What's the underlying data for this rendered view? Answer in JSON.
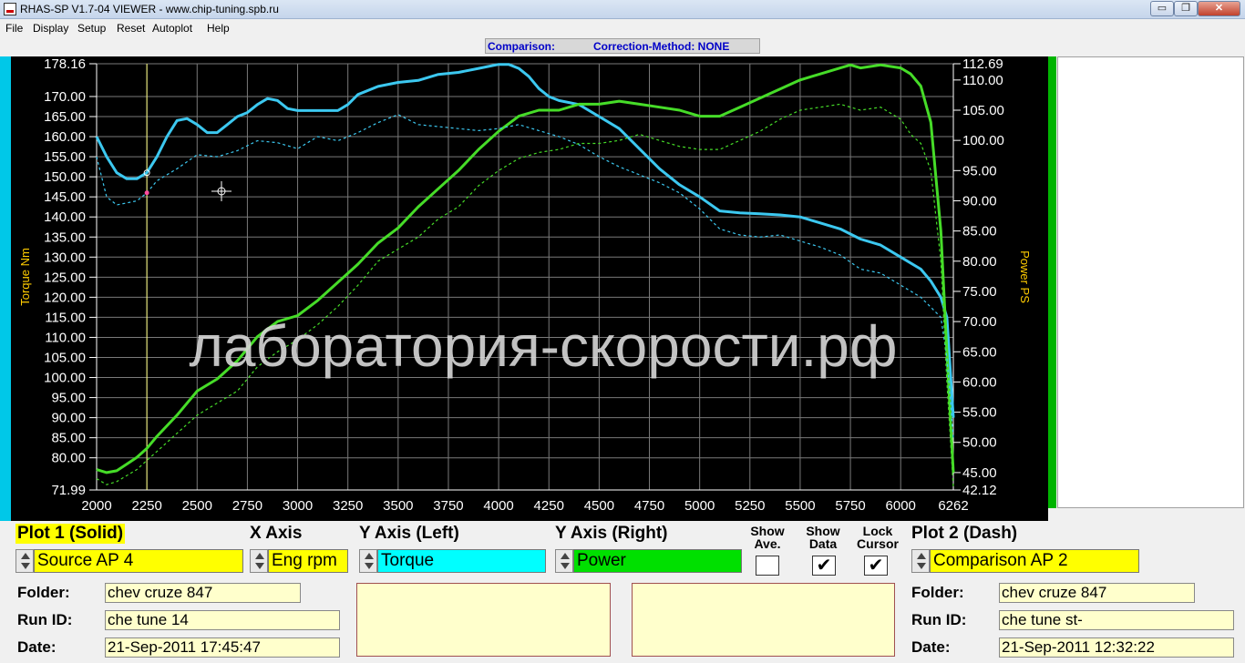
{
  "window": {
    "title": "RHAS-SP V1.7-04  VIEWER - www.chip-tuning.spb.ru",
    "min_glyph": "▭",
    "max_glyph": "❐",
    "close_glyph": "✕"
  },
  "menu": [
    "File",
    "Display",
    "Setup",
    "Reset",
    "Autoplot",
    "Help"
  ],
  "header": {
    "comparison": "Comparison:",
    "correction": "Correction-Method: NONE"
  },
  "chart_data": {
    "type": "line",
    "ylabel_left": "Torque Nm",
    "ylabel_right": "Power PS",
    "watermark": "лаборатория-скорости.рф",
    "xlim": [
      2000,
      6262
    ],
    "ylim_left": [
      71.99,
      178.16
    ],
    "ylim_right": [
      42.12,
      112.69
    ],
    "x_ticks": [
      "2000",
      "2250",
      "2500",
      "2750",
      "3000",
      "3250",
      "3500",
      "3750",
      "4000",
      "4250",
      "4500",
      "4750",
      "5000",
      "5250",
      "5500",
      "5750",
      "6000",
      "6262"
    ],
    "y_ticks_left": [
      "178.16",
      "170.00",
      "165.00",
      "160.00",
      "155.00",
      "150.00",
      "145.00",
      "140.00",
      "135.00",
      "130.00",
      "125.00",
      "120.00",
      "115.00",
      "110.00",
      "105.00",
      "100.00",
      "95.00",
      "90.00",
      "85.00",
      "80.00",
      "71.99"
    ],
    "y_ticks_right": [
      "112.69",
      "110.00",
      "105.00",
      "100.00",
      "95.00",
      "90.00",
      "85.00",
      "80.00",
      "75.00",
      "70.00",
      "65.00",
      "60.00",
      "55.00",
      "50.00",
      "45.00",
      "42.12"
    ],
    "cursor_x": 2250,
    "grid": true,
    "series": [
      {
        "name": "Torque",
        "axis": "left",
        "style": "solid",
        "color": "#3cc8f0",
        "x": [
          2000,
          2050,
          2100,
          2150,
          2200,
          2250,
          2300,
          2350,
          2400,
          2450,
          2500,
          2550,
          2600,
          2650,
          2700,
          2750,
          2800,
          2850,
          2900,
          2950,
          3000,
          3100,
          3200,
          3250,
          3300,
          3400,
          3500,
          3600,
          3700,
          3800,
          3900,
          3950,
          4000,
          4050,
          4100,
          4150,
          4200,
          4250,
          4300,
          4400,
          4500,
          4600,
          4700,
          4800,
          4900,
          5000,
          5100,
          5200,
          5300,
          5400,
          5500,
          5600,
          5700,
          5800,
          5900,
          6000,
          6100,
          6150,
          6200,
          6230,
          6262
        ],
        "y": [
          160.0,
          155.0,
          151.0,
          149.5,
          149.5,
          151.0,
          155.0,
          160.0,
          164.0,
          164.5,
          163.0,
          161.0,
          161.0,
          163.0,
          165.0,
          166.0,
          168.0,
          169.5,
          169.0,
          167.0,
          166.5,
          166.5,
          166.5,
          168.0,
          170.5,
          172.5,
          173.5,
          174.0,
          175.5,
          176.0,
          177.0,
          177.5,
          178.0,
          178.0,
          177.0,
          175.0,
          172.0,
          170.0,
          169.0,
          168.0,
          165.0,
          162.0,
          157.0,
          152.0,
          148.0,
          145.0,
          141.5,
          141.0,
          140.8,
          140.5,
          140.0,
          138.5,
          137.0,
          134.5,
          133.0,
          130.0,
          127.0,
          124.0,
          120.0,
          115.0,
          90.0
        ]
      },
      {
        "name": "Power",
        "axis": "right",
        "style": "solid",
        "color": "#46dc28",
        "x": [
          2000,
          2050,
          2100,
          2200,
          2250,
          2300,
          2400,
          2500,
          2600,
          2700,
          2800,
          2900,
          3000,
          3100,
          3200,
          3300,
          3400,
          3500,
          3600,
          3700,
          3800,
          3900,
          4000,
          4100,
          4200,
          4300,
          4400,
          4500,
          4600,
          4700,
          4800,
          4900,
          5000,
          5100,
          5200,
          5300,
          5400,
          5500,
          5600,
          5700,
          5750,
          5800,
          5900,
          6000,
          6050,
          6100,
          6150,
          6200,
          6230,
          6262
        ],
        "y": [
          45.5,
          45.0,
          45.3,
          47.5,
          49.0,
          51.0,
          54.5,
          58.5,
          60.5,
          63.5,
          67.5,
          70.0,
          71.0,
          73.5,
          76.5,
          79.5,
          83.0,
          85.5,
          89.0,
          92.0,
          95.0,
          98.5,
          101.5,
          104.0,
          105.0,
          105.0,
          106.0,
          106.0,
          106.5,
          106.0,
          105.5,
          105.0,
          104.0,
          104.0,
          105.5,
          107.0,
          108.5,
          110.0,
          111.0,
          112.0,
          112.5,
          112.0,
          112.5,
          112.0,
          111.0,
          109.0,
          103.0,
          85.0,
          65.0,
          45.0
        ]
      },
      {
        "name": "Comparison Torque",
        "axis": "left",
        "style": "dash",
        "color": "#3cc8f0",
        "x": [
          2000,
          2050,
          2100,
          2200,
          2250,
          2300,
          2400,
          2500,
          2600,
          2700,
          2800,
          2900,
          3000,
          3100,
          3200,
          3300,
          3400,
          3500,
          3600,
          3700,
          3800,
          3900,
          4000,
          4100,
          4200,
          4300,
          4400,
          4500,
          4600,
          4700,
          4800,
          4900,
          5000,
          5100,
          5200,
          5300,
          5400,
          5500,
          5600,
          5700,
          5800,
          5900,
          6000,
          6100,
          6150,
          6200,
          6230,
          6262
        ],
        "y": [
          155.0,
          145.0,
          143.0,
          144.0,
          146.0,
          149.0,
          152.0,
          155.5,
          155.0,
          156.5,
          159.0,
          158.5,
          157.0,
          160.0,
          159.0,
          161.0,
          163.5,
          165.5,
          163.0,
          162.5,
          162.0,
          161.5,
          162.0,
          163.0,
          161.5,
          160.0,
          158.0,
          155.0,
          152.5,
          150.5,
          148.5,
          146.0,
          142.0,
          137.0,
          135.5,
          135.0,
          135.5,
          134.0,
          132.5,
          130.5,
          127.0,
          126.0,
          123.0,
          120.0,
          117.5,
          115.0,
          105.0,
          85.0
        ]
      },
      {
        "name": "Comparison Power",
        "axis": "right",
        "style": "dash",
        "color": "#46dc28",
        "x": [
          2000,
          2050,
          2100,
          2200,
          2250,
          2300,
          2400,
          2500,
          2600,
          2700,
          2800,
          2900,
          3000,
          3100,
          3200,
          3300,
          3400,
          3500,
          3600,
          3700,
          3800,
          3900,
          4000,
          4100,
          4200,
          4300,
          4400,
          4500,
          4600,
          4700,
          4800,
          4900,
          5000,
          5100,
          5200,
          5300,
          5400,
          5500,
          5600,
          5700,
          5750,
          5800,
          5900,
          6000,
          6050,
          6100,
          6150,
          6200,
          6230,
          6262
        ],
        "y": [
          44.0,
          43.0,
          43.5,
          45.5,
          47.0,
          48.5,
          51.5,
          54.5,
          56.5,
          58.5,
          62.5,
          65.0,
          67.0,
          69.5,
          72.5,
          76.0,
          80.0,
          82.0,
          84.0,
          87.0,
          89.0,
          92.5,
          95.0,
          97.0,
          98.0,
          98.5,
          99.5,
          99.5,
          100.0,
          101.0,
          100.0,
          99.0,
          98.5,
          98.5,
          100.0,
          101.5,
          103.5,
          105.0,
          105.5,
          106.0,
          105.5,
          105.0,
          105.5,
          103.5,
          101.0,
          99.5,
          95.0,
          80.0,
          60.0,
          42.5
        ]
      }
    ]
  },
  "controls": {
    "plot1": {
      "label": "Plot 1 (Solid)",
      "value": "Source AP 4",
      "color": "#ffff00"
    },
    "x_axis": {
      "label": "X Axis",
      "value": "Eng rpm",
      "color": "#ffff00"
    },
    "y_left": {
      "label": "Y Axis (Left)",
      "value": "Torque",
      "color": "#00ffff"
    },
    "y_right": {
      "label": "Y Axis (Right)",
      "value": "Power",
      "color": "#00e000"
    },
    "show_ave": {
      "label_line1": "Show",
      "label_line2": "Ave.",
      "mark": ""
    },
    "show_data": {
      "label_line1": "Show",
      "label_line2": "Data",
      "mark": "✔"
    },
    "lock_cursor": {
      "label_line1": "Lock",
      "label_line2": "Cursor",
      "mark": "✔"
    },
    "plot2": {
      "label": "Plot 2 (Dash)",
      "value": "Comparison AP 2",
      "color": "#ffff00"
    }
  },
  "run1": {
    "folder_label": "Folder:",
    "folder": "chev cruze 847",
    "runid_label": "Run ID:",
    "runid": "che tune 14",
    "date_label": "Date:",
    "date": "21-Sep-2011  17:45:47"
  },
  "run2": {
    "folder_label": "Folder:",
    "folder": "chev cruze 847",
    "runid_label": "Run ID:",
    "runid": "che tune st-",
    "date_label": "Date:",
    "date": "21-Sep-2011  12:32:22"
  }
}
